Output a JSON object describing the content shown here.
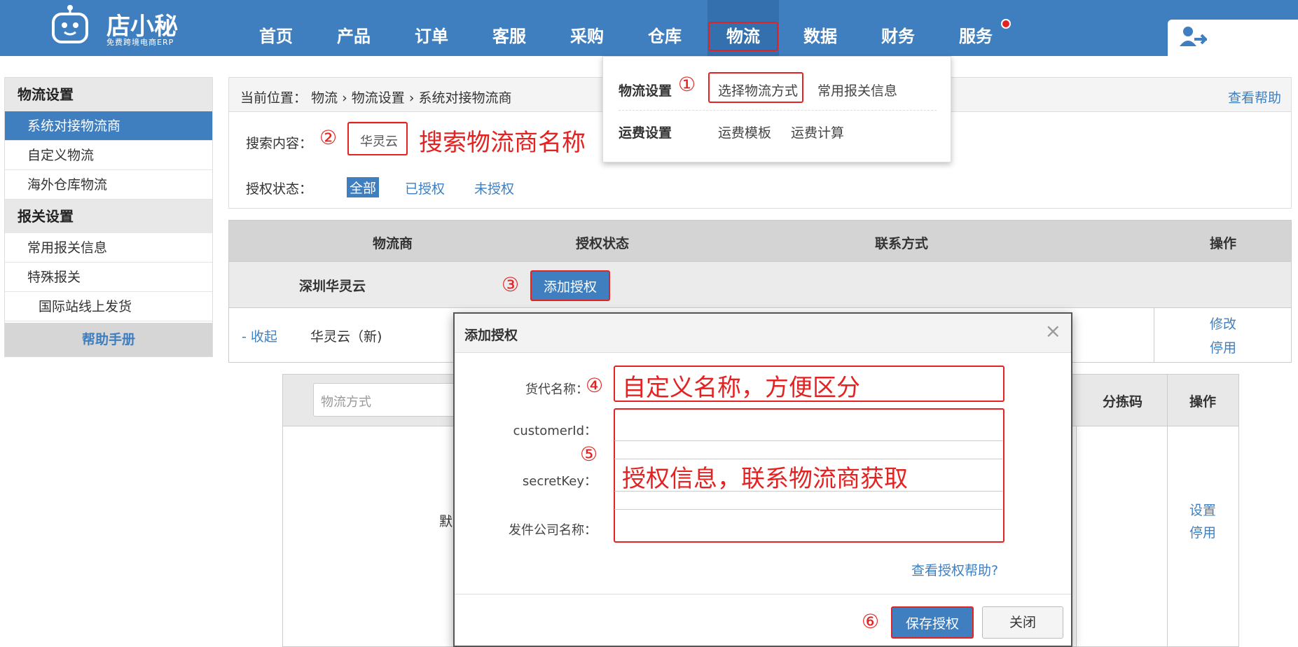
{
  "brand": {
    "name": "店小秘",
    "subtitle": "免费跨境电商ERP"
  },
  "nav": {
    "items": [
      "首页",
      "产品",
      "订单",
      "客服",
      "采购",
      "仓库",
      "物流",
      "数据",
      "财务",
      "服务"
    ],
    "active": "物流"
  },
  "dropdown": {
    "group1_title": "物流设置",
    "group1_items": [
      "选择物流方式",
      "常用报关信息"
    ],
    "group2_title": "运费设置",
    "group2_items": [
      "运费模板",
      "运费计算"
    ]
  },
  "sidebar": {
    "section1": "物流设置",
    "items1": [
      "系统对接物流商",
      "自定义物流",
      "海外仓库物流"
    ],
    "section2": "报关设置",
    "items2": [
      "常用报关信息",
      "特殊报关"
    ],
    "sub_item": "国际站线上发货",
    "help": "帮助手册"
  },
  "breadcrumb": {
    "prefix": "当前位置：",
    "path": [
      "物流",
      "物流设置",
      "系统对接物流商"
    ],
    "help_link": "查看帮助"
  },
  "filter": {
    "search_label": "搜索内容：",
    "search_value": "华灵云",
    "auth_label": "授权状态：",
    "auth_options": [
      "全部",
      "已授权",
      "未授权"
    ]
  },
  "table": {
    "headers": [
      "物流商",
      "授权状态",
      "联系方式",
      "操作"
    ],
    "group_name": "深圳华灵云",
    "add_auth_button": "添加授权",
    "sub_row": {
      "collapse": "- 收起",
      "name": "华灵云（新)",
      "actions": [
        "修改",
        "停用"
      ]
    }
  },
  "inner_table": {
    "method_placeholder": "物流方式",
    "headers": [
      "分拣码",
      "操作"
    ],
    "partial_text": "默",
    "actions": [
      "设置",
      "停用"
    ]
  },
  "modal": {
    "title": "添加授权",
    "close": "×",
    "fields": [
      "货代名称：",
      "customerId：",
      "secretKey：",
      "发件公司名称："
    ],
    "help_link": "查看授权帮助?",
    "save_button": "保存授权",
    "close_button": "关闭"
  },
  "annotations": {
    "markers": [
      "①",
      "②",
      "③",
      "④",
      "⑤",
      "⑥"
    ],
    "search_hint": "搜索物流商名称",
    "name_hint": "自定义名称，方便区分",
    "auth_hint": "授权信息，联系物流商获取"
  },
  "colors": {
    "primary": "#3f7fc0",
    "annotation": "#e52222"
  }
}
